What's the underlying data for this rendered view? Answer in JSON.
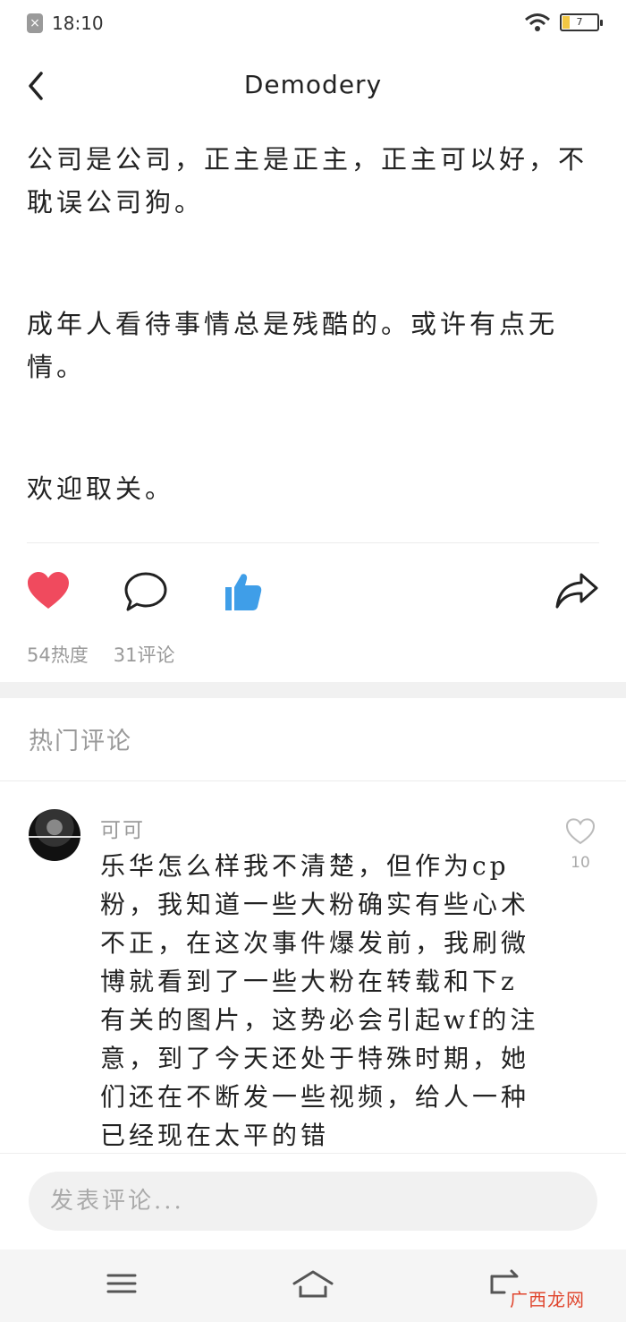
{
  "status_bar": {
    "time": "18:10",
    "battery": "7",
    "battery_level": 0.07
  },
  "header": {
    "title": "Demodery"
  },
  "post": {
    "paragraphs": [
      "公司是公司，正主是正主，正主可以好，不耽误公司狗。",
      "成年人看待事情总是残酷的。或许有点无情。",
      "欢迎取关。"
    ]
  },
  "actions": {
    "heat": "54热度",
    "comments": "31评论"
  },
  "hot_comments": {
    "title": "热门评论",
    "items": [
      {
        "author": "可可",
        "likes": "10",
        "text": "乐华怎么样我不清楚，但作为cp粉，我知道一些大粉确实有些心术不正，在这次事件爆发前，我刷微博就看到了一些大粉在转载和下z有关的图片，这势必会引起wf的注意，到了今天还处于特殊时期，她们还在不断发一些视频，给人一种已经现在太平的错"
      }
    ]
  },
  "input": {
    "placeholder": "发表评论..."
  },
  "watermark": "广西龙网",
  "colors": {
    "heart": "#f04a5e",
    "thumb": "#3f9ee8",
    "battery": "#f2c744"
  }
}
